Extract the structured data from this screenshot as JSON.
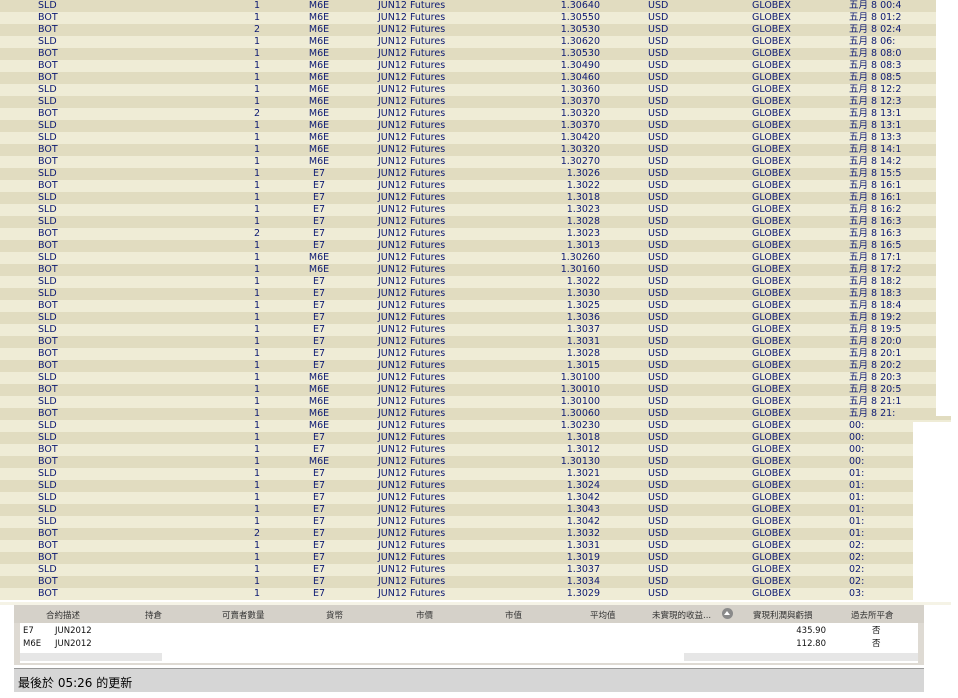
{
  "trades": [
    {
      "side": "SLD",
      "qty": "1",
      "symbol": "M6E",
      "description": "JUN12 Futures",
      "price": "1.30640",
      "currency": "USD",
      "exchange": "GLOBEX",
      "time": "五月 8 00:4"
    },
    {
      "side": "BOT",
      "qty": "1",
      "symbol": "M6E",
      "description": "JUN12 Futures",
      "price": "1.30550",
      "currency": "USD",
      "exchange": "GLOBEX",
      "time": "五月 8 01:2"
    },
    {
      "side": "BOT",
      "qty": "2",
      "symbol": "M6E",
      "description": "JUN12 Futures",
      "price": "1.30530",
      "currency": "USD",
      "exchange": "GLOBEX",
      "time": "五月 8 02:4"
    },
    {
      "side": "SLD",
      "qty": "1",
      "symbol": "M6E",
      "description": "JUN12 Futures",
      "price": "1.30620",
      "currency": "USD",
      "exchange": "GLOBEX",
      "time": "五月 8 06:"
    },
    {
      "side": "BOT",
      "qty": "1",
      "symbol": "M6E",
      "description": "JUN12 Futures",
      "price": "1.30530",
      "currency": "USD",
      "exchange": "GLOBEX",
      "time": "五月 8 08:0"
    },
    {
      "side": "BOT",
      "qty": "1",
      "symbol": "M6E",
      "description": "JUN12 Futures",
      "price": "1.30490",
      "currency": "USD",
      "exchange": "GLOBEX",
      "time": "五月 8 08:3"
    },
    {
      "side": "BOT",
      "qty": "1",
      "symbol": "M6E",
      "description": "JUN12 Futures",
      "price": "1.30460",
      "currency": "USD",
      "exchange": "GLOBEX",
      "time": "五月 8 08:5"
    },
    {
      "side": "SLD",
      "qty": "1",
      "symbol": "M6E",
      "description": "JUN12 Futures",
      "price": "1.30360",
      "currency": "USD",
      "exchange": "GLOBEX",
      "time": "五月 8 12:2"
    },
    {
      "side": "SLD",
      "qty": "1",
      "symbol": "M6E",
      "description": "JUN12 Futures",
      "price": "1.30370",
      "currency": "USD",
      "exchange": "GLOBEX",
      "time": "五月 8 12:3"
    },
    {
      "side": "BOT",
      "qty": "2",
      "symbol": "M6E",
      "description": "JUN12 Futures",
      "price": "1.30320",
      "currency": "USD",
      "exchange": "GLOBEX",
      "time": "五月 8 13:1"
    },
    {
      "side": "SLD",
      "qty": "1",
      "symbol": "M6E",
      "description": "JUN12 Futures",
      "price": "1.30370",
      "currency": "USD",
      "exchange": "GLOBEX",
      "time": "五月 8 13:1"
    },
    {
      "side": "SLD",
      "qty": "1",
      "symbol": "M6E",
      "description": "JUN12 Futures",
      "price": "1.30420",
      "currency": "USD",
      "exchange": "GLOBEX",
      "time": "五月 8 13:3"
    },
    {
      "side": "BOT",
      "qty": "1",
      "symbol": "M6E",
      "description": "JUN12 Futures",
      "price": "1.30320",
      "currency": "USD",
      "exchange": "GLOBEX",
      "time": "五月 8 14:1"
    },
    {
      "side": "BOT",
      "qty": "1",
      "symbol": "M6E",
      "description": "JUN12 Futures",
      "price": "1.30270",
      "currency": "USD",
      "exchange": "GLOBEX",
      "time": "五月 8 14:2"
    },
    {
      "side": "SLD",
      "qty": "1",
      "symbol": "E7",
      "description": "JUN12 Futures",
      "price": "1.3026",
      "currency": "USD",
      "exchange": "GLOBEX",
      "time": "五月 8 15:5"
    },
    {
      "side": "BOT",
      "qty": "1",
      "symbol": "E7",
      "description": "JUN12 Futures",
      "price": "1.3022",
      "currency": "USD",
      "exchange": "GLOBEX",
      "time": "五月 8 16:1"
    },
    {
      "side": "SLD",
      "qty": "1",
      "symbol": "E7",
      "description": "JUN12 Futures",
      "price": "1.3018",
      "currency": "USD",
      "exchange": "GLOBEX",
      "time": "五月 8 16:1"
    },
    {
      "side": "SLD",
      "qty": "1",
      "symbol": "E7",
      "description": "JUN12 Futures",
      "price": "1.3023",
      "currency": "USD",
      "exchange": "GLOBEX",
      "time": "五月 8 16:2"
    },
    {
      "side": "SLD",
      "qty": "1",
      "symbol": "E7",
      "description": "JUN12 Futures",
      "price": "1.3028",
      "currency": "USD",
      "exchange": "GLOBEX",
      "time": "五月 8 16:3"
    },
    {
      "side": "BOT",
      "qty": "2",
      "symbol": "E7",
      "description": "JUN12 Futures",
      "price": "1.3023",
      "currency": "USD",
      "exchange": "GLOBEX",
      "time": "五月 8 16:3"
    },
    {
      "side": "BOT",
      "qty": "1",
      "symbol": "E7",
      "description": "JUN12 Futures",
      "price": "1.3013",
      "currency": "USD",
      "exchange": "GLOBEX",
      "time": "五月 8 16:5"
    },
    {
      "side": "SLD",
      "qty": "1",
      "symbol": "M6E",
      "description": "JUN12 Futures",
      "price": "1.30260",
      "currency": "USD",
      "exchange": "GLOBEX",
      "time": "五月 8 17:1"
    },
    {
      "side": "BOT",
      "qty": "1",
      "symbol": "M6E",
      "description": "JUN12 Futures",
      "price": "1.30160",
      "currency": "USD",
      "exchange": "GLOBEX",
      "time": "五月 8 17:2"
    },
    {
      "side": "SLD",
      "qty": "1",
      "symbol": "E7",
      "description": "JUN12 Futures",
      "price": "1.3022",
      "currency": "USD",
      "exchange": "GLOBEX",
      "time": "五月 8 18:2"
    },
    {
      "side": "SLD",
      "qty": "1",
      "symbol": "E7",
      "description": "JUN12 Futures",
      "price": "1.3030",
      "currency": "USD",
      "exchange": "GLOBEX",
      "time": "五月 8 18:3"
    },
    {
      "side": "BOT",
      "qty": "1",
      "symbol": "E7",
      "description": "JUN12 Futures",
      "price": "1.3025",
      "currency": "USD",
      "exchange": "GLOBEX",
      "time": "五月 8 18:4"
    },
    {
      "side": "SLD",
      "qty": "1",
      "symbol": "E7",
      "description": "JUN12 Futures",
      "price": "1.3036",
      "currency": "USD",
      "exchange": "GLOBEX",
      "time": "五月 8 19:2"
    },
    {
      "side": "SLD",
      "qty": "1",
      "symbol": "E7",
      "description": "JUN12 Futures",
      "price": "1.3037",
      "currency": "USD",
      "exchange": "GLOBEX",
      "time": "五月 8 19:5"
    },
    {
      "side": "BOT",
      "qty": "1",
      "symbol": "E7",
      "description": "JUN12 Futures",
      "price": "1.3031",
      "currency": "USD",
      "exchange": "GLOBEX",
      "time": "五月 8 20:0"
    },
    {
      "side": "BOT",
      "qty": "1",
      "symbol": "E7",
      "description": "JUN12 Futures",
      "price": "1.3028",
      "currency": "USD",
      "exchange": "GLOBEX",
      "time": "五月 8 20:1"
    },
    {
      "side": "BOT",
      "qty": "1",
      "symbol": "E7",
      "description": "JUN12 Futures",
      "price": "1.3015",
      "currency": "USD",
      "exchange": "GLOBEX",
      "time": "五月 8 20:2"
    },
    {
      "side": "SLD",
      "qty": "1",
      "symbol": "M6E",
      "description": "JUN12 Futures",
      "price": "1.30100",
      "currency": "USD",
      "exchange": "GLOBEX",
      "time": "五月 8 20:3"
    },
    {
      "side": "BOT",
      "qty": "1",
      "symbol": "M6E",
      "description": "JUN12 Futures",
      "price": "1.30010",
      "currency": "USD",
      "exchange": "GLOBEX",
      "time": "五月 8 20:5"
    },
    {
      "side": "SLD",
      "qty": "1",
      "symbol": "M6E",
      "description": "JUN12 Futures",
      "price": "1.30100",
      "currency": "USD",
      "exchange": "GLOBEX",
      "time": "五月 8 21:1"
    },
    {
      "side": "BOT",
      "qty": "1",
      "symbol": "M6E",
      "description": "JUN12 Futures",
      "price": "1.30060",
      "currency": "USD",
      "exchange": "GLOBEX",
      "time": "五月 8 21:"
    },
    {
      "side": "SLD",
      "qty": "1",
      "symbol": "M6E",
      "description": "JUN12 Futures",
      "price": "1.30230",
      "currency": "USD",
      "exchange": "GLOBEX",
      "time": "00:"
    },
    {
      "side": "SLD",
      "qty": "1",
      "symbol": "E7",
      "description": "JUN12 Futures",
      "price": "1.3018",
      "currency": "USD",
      "exchange": "GLOBEX",
      "time": "00:"
    },
    {
      "side": "BOT",
      "qty": "1",
      "symbol": "E7",
      "description": "JUN12 Futures",
      "price": "1.3012",
      "currency": "USD",
      "exchange": "GLOBEX",
      "time": "00:"
    },
    {
      "side": "BOT",
      "qty": "1",
      "symbol": "M6E",
      "description": "JUN12 Futures",
      "price": "1.30130",
      "currency": "USD",
      "exchange": "GLOBEX",
      "time": "00:"
    },
    {
      "side": "SLD",
      "qty": "1",
      "symbol": "E7",
      "description": "JUN12 Futures",
      "price": "1.3021",
      "currency": "USD",
      "exchange": "GLOBEX",
      "time": "01:"
    },
    {
      "side": "SLD",
      "qty": "1",
      "symbol": "E7",
      "description": "JUN12 Futures",
      "price": "1.3024",
      "currency": "USD",
      "exchange": "GLOBEX",
      "time": "01:"
    },
    {
      "side": "SLD",
      "qty": "1",
      "symbol": "E7",
      "description": "JUN12 Futures",
      "price": "1.3042",
      "currency": "USD",
      "exchange": "GLOBEX",
      "time": "01:"
    },
    {
      "side": "SLD",
      "qty": "1",
      "symbol": "E7",
      "description": "JUN12 Futures",
      "price": "1.3043",
      "currency": "USD",
      "exchange": "GLOBEX",
      "time": "01:"
    },
    {
      "side": "SLD",
      "qty": "1",
      "symbol": "E7",
      "description": "JUN12 Futures",
      "price": "1.3042",
      "currency": "USD",
      "exchange": "GLOBEX",
      "time": "01:"
    },
    {
      "side": "BOT",
      "qty": "2",
      "symbol": "E7",
      "description": "JUN12 Futures",
      "price": "1.3032",
      "currency": "USD",
      "exchange": "GLOBEX",
      "time": "01:"
    },
    {
      "side": "BOT",
      "qty": "1",
      "symbol": "E7",
      "description": "JUN12 Futures",
      "price": "1.3031",
      "currency": "USD",
      "exchange": "GLOBEX",
      "time": "02:"
    },
    {
      "side": "BOT",
      "qty": "1",
      "symbol": "E7",
      "description": "JUN12 Futures",
      "price": "1.3019",
      "currency": "USD",
      "exchange": "GLOBEX",
      "time": "02:"
    },
    {
      "side": "SLD",
      "qty": "1",
      "symbol": "E7",
      "description": "JUN12 Futures",
      "price": "1.3037",
      "currency": "USD",
      "exchange": "GLOBEX",
      "time": "02:"
    },
    {
      "side": "BOT",
      "qty": "1",
      "symbol": "E7",
      "description": "JUN12 Futures",
      "price": "1.3034",
      "currency": "USD",
      "exchange": "GLOBEX",
      "time": "02:"
    },
    {
      "side": "BOT",
      "qty": "1",
      "symbol": "E7",
      "description": "JUN12 Futures",
      "price": "1.3029",
      "currency": "USD",
      "exchange": "GLOBEX",
      "time": "03:"
    }
  ],
  "portfolio": {
    "headers": [
      "合約描述",
      "持倉",
      "可賣者數量",
      "貨幣",
      "市價",
      "市值",
      "平均值",
      "未實現的收益...",
      "實現利潤與虧損",
      "過去所平倉"
    ],
    "rows": [
      {
        "symbol": "E7",
        "expiry": "JUN2012",
        "realized_pnl": "435.90",
        "closed": "否"
      },
      {
        "symbol": "M6E",
        "expiry": "JUN2012",
        "realized_pnl": "112.80",
        "closed": "否"
      }
    ]
  },
  "status": {
    "text": "最後於 05:26 的更新"
  },
  "colors": {
    "row_even": "#e1dcc0",
    "row_odd": "#efecd6",
    "row_text": "#0d1a73"
  }
}
